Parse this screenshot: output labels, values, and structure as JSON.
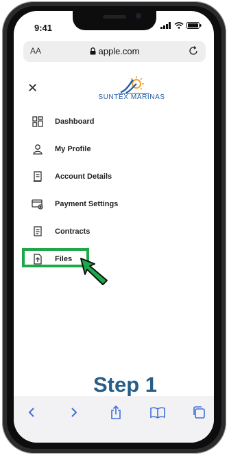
{
  "status_bar": {
    "time": "9:41"
  },
  "browser": {
    "text_size_label": "AA",
    "url": "apple.com"
  },
  "brand": {
    "name": "SUNTEX MARINAS"
  },
  "menu": {
    "items": [
      {
        "label": "Dashboard",
        "icon": "dashboard-icon"
      },
      {
        "label": "My Profile",
        "icon": "profile-icon"
      },
      {
        "label": "Account Details",
        "icon": "document-icon"
      },
      {
        "label": "Payment Settings",
        "icon": "payment-settings-icon"
      },
      {
        "label": "Contracts",
        "icon": "contract-icon"
      },
      {
        "label": "Files",
        "icon": "upload-file-icon"
      }
    ]
  },
  "annotation": {
    "step": "Step 1",
    "highlight_color": "#1ea84a",
    "text_color": "#275d87"
  },
  "colors": {
    "brand_blue": "#1f5aa6",
    "logo_orange": "#f2a12b"
  }
}
